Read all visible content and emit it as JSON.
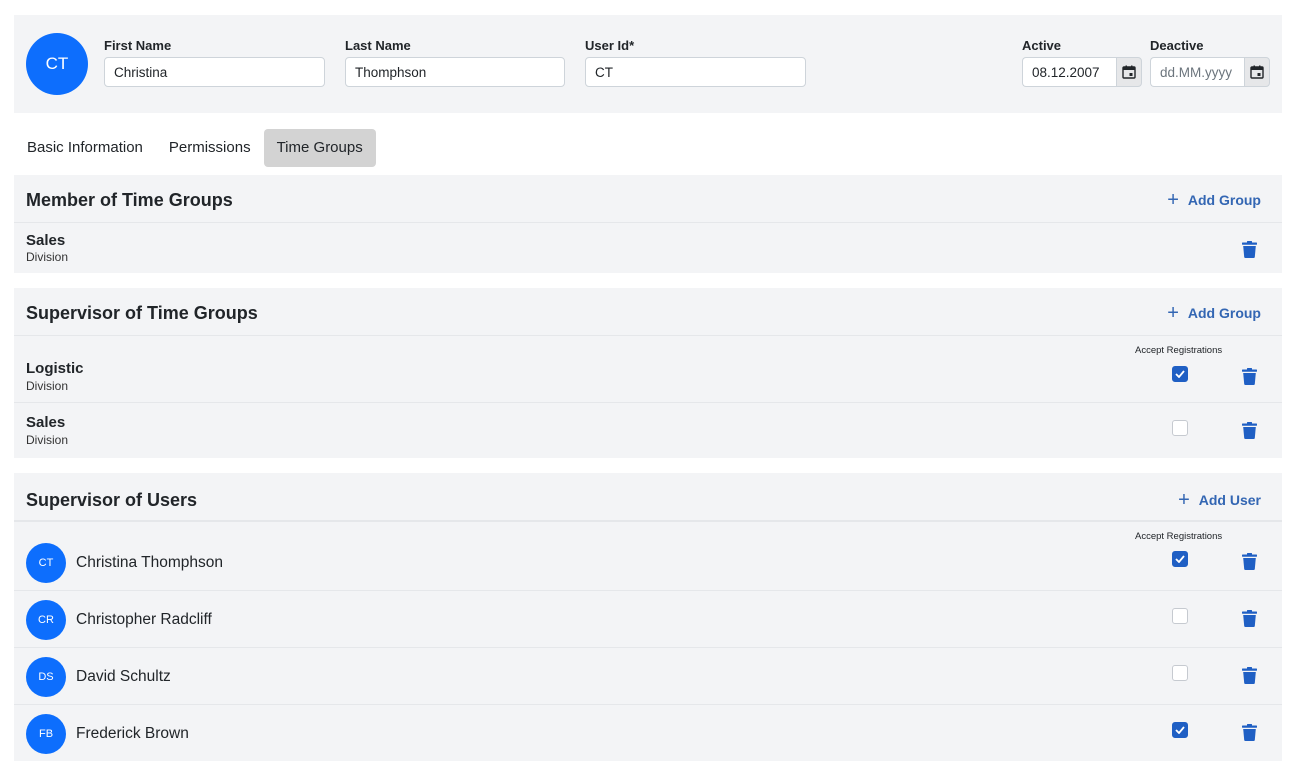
{
  "header": {
    "avatar_initials": "CT",
    "first_name": {
      "label": "First Name",
      "value": "Christina"
    },
    "last_name": {
      "label": "Last Name",
      "value": "Thomphson"
    },
    "user_id": {
      "label": "User Id*",
      "value": "CT"
    },
    "active": {
      "label": "Active",
      "value": "08.12.2007"
    },
    "deactive": {
      "label": "Deactive",
      "value": "",
      "placeholder": "dd.MM.yyyy"
    }
  },
  "tabs": [
    {
      "label": "Basic Information",
      "active": false
    },
    {
      "label": "Permissions",
      "active": false
    },
    {
      "label": "Time Groups",
      "active": true
    }
  ],
  "member_groups": {
    "title": "Member of Time Groups",
    "add_label": "Add Group",
    "items": [
      {
        "name": "Sales",
        "type": "Division"
      }
    ]
  },
  "supervisor_groups": {
    "title": "Supervisor of Time Groups",
    "add_label": "Add Group",
    "accept_label": "Accept Registrations",
    "items": [
      {
        "name": "Logistic",
        "type": "Division",
        "accept": true
      },
      {
        "name": "Sales",
        "type": "Division",
        "accept": false
      }
    ]
  },
  "supervisor_users": {
    "title": "Supervisor of Users",
    "add_label": "Add User",
    "accept_label": "Accept Registrations",
    "items": [
      {
        "initials": "CT",
        "name": "Christina Thomphson",
        "accept": true
      },
      {
        "initials": "CR",
        "name": "Christopher Radcliff",
        "accept": false
      },
      {
        "initials": "DS",
        "name": "David Schultz",
        "accept": false
      },
      {
        "initials": "FB",
        "name": "Frederick Brown",
        "accept": true
      }
    ]
  },
  "colors": {
    "accent": "#0d6efd",
    "link": "#3366b3",
    "checkbox_on": "#1f5fc4",
    "panel_bg": "#f3f4f6",
    "active_tab_bg": "#d3d3d3"
  }
}
